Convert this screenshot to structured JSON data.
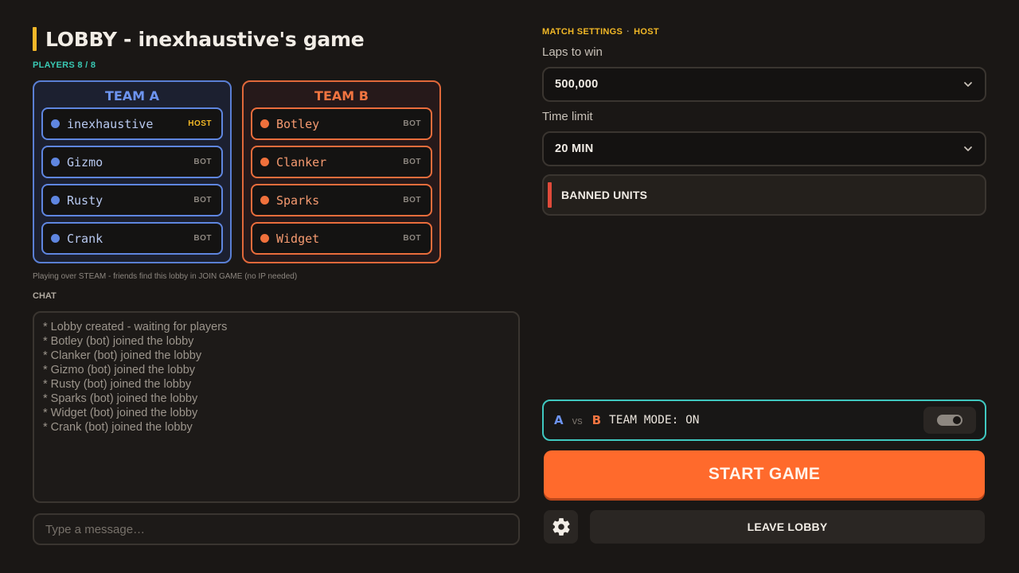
{
  "lobby": {
    "title": "LOBBY - inexhaustive's game",
    "players_count": "PLAYERS 8 / 8",
    "steam_note": "Playing over STEAM - friends find this lobby in JOIN GAME (no IP needed)"
  },
  "teams": {
    "a": {
      "title": "TEAM A",
      "players": [
        {
          "name": "inexhaustive",
          "tag": "HOST"
        },
        {
          "name": "Gizmo",
          "tag": "BOT"
        },
        {
          "name": "Rusty",
          "tag": "BOT"
        },
        {
          "name": "Crank",
          "tag": "BOT"
        }
      ]
    },
    "b": {
      "title": "TEAM B",
      "players": [
        {
          "name": "Botley",
          "tag": "BOT"
        },
        {
          "name": "Clanker",
          "tag": "BOT"
        },
        {
          "name": "Sparks",
          "tag": "BOT"
        },
        {
          "name": "Widget",
          "tag": "BOT"
        }
      ]
    }
  },
  "chat": {
    "label": "CHAT",
    "lines": [
      "* Lobby created - waiting for players",
      "* Botley (bot) joined the lobby",
      "* Clanker (bot) joined the lobby",
      "* Gizmo (bot) joined the lobby",
      "* Rusty (bot) joined the lobby",
      "* Sparks (bot) joined the lobby",
      "* Widget (bot) joined the lobby",
      "* Crank (bot) joined the lobby"
    ],
    "input_placeholder": "Type a message…",
    "input_value": ""
  },
  "settings": {
    "header": "MATCH SETTINGS",
    "header_sep": "·",
    "header_role": "HOST",
    "laps_label": "Laps to win",
    "laps_value": "500,000",
    "time_label": "Time limit",
    "time_value": "20 MIN",
    "banned_units_label": "BANNED UNITS"
  },
  "team_mode": {
    "a_letter": "A",
    "vs": "vs",
    "b_letter": "B",
    "label": "TEAM MODE: ON",
    "enabled": true
  },
  "actions": {
    "start_label": "START GAME",
    "leave_label": "LEAVE LOBBY",
    "settings_icon": "gear-icon"
  },
  "colors": {
    "accent": "#ff6a2c",
    "team_a": "#5f86e0",
    "team_b": "#ea6d3c",
    "host": "#f2b826",
    "team_mode_border": "#3fc8c0"
  }
}
